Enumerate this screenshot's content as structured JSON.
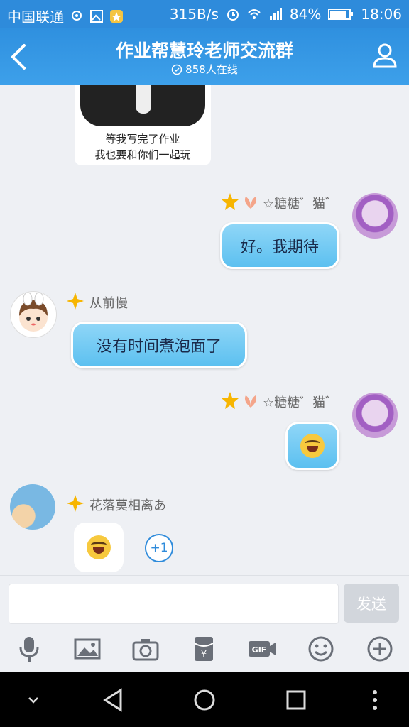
{
  "status": {
    "carrier": "中国联通",
    "speed": "315B/s",
    "battery": "84%",
    "time": "18:06"
  },
  "header": {
    "title": "作业帮慧玲老师交流群",
    "online": "858人在线"
  },
  "sticker": {
    "line1": "等我写完了作业",
    "line2": "我也要和你们一起玩"
  },
  "messages": [
    {
      "user": "☆糖糖゛猫゛",
      "text": "好。我期待"
    },
    {
      "user": "从前慢",
      "text": "没有时间煮泡面了"
    },
    {
      "user": "☆糖糖゛猫゛"
    },
    {
      "user": "花落莫相离あ"
    }
  ],
  "plus_one": "+1",
  "input": {
    "placeholder": "",
    "send_label": "发送"
  },
  "toolbar": [
    "microphone-icon",
    "image-icon",
    "camera-icon",
    "red-packet-icon",
    "gif-icon",
    "emoji-icon",
    "plus-icon"
  ],
  "colors": {
    "header": "#2e8bdb",
    "bubble": "#6cc6f2",
    "accent": "#2e8bdb"
  }
}
